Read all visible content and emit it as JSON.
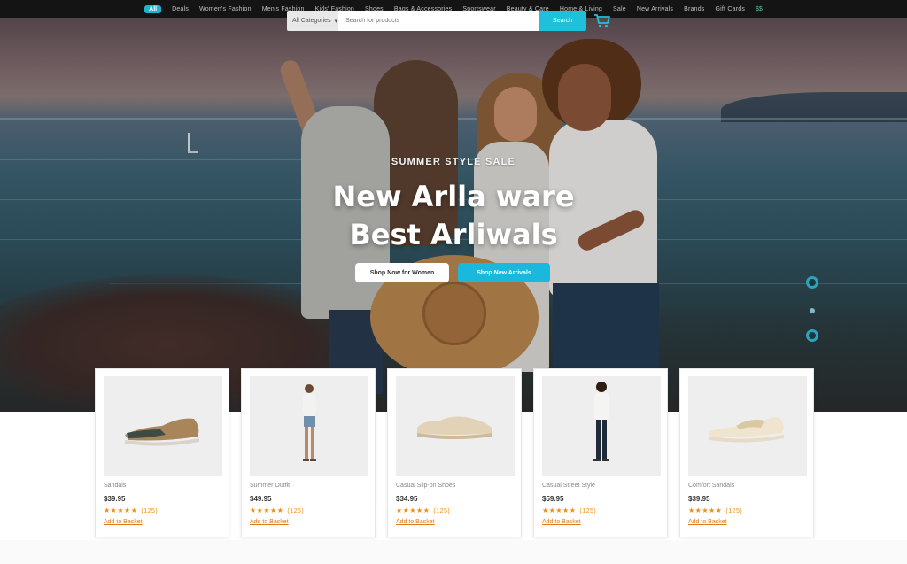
{
  "nav": {
    "badge": "All",
    "items": [
      "Deals",
      "Women's Fashion",
      "Men's Fashion",
      "Kids' Fashion",
      "Shoes",
      "Bags & Accessories",
      "Sportswear",
      "Beauty & Care",
      "Home & Living",
      "Sale",
      "New Arrivals",
      "Brands",
      "Gift Cards"
    ],
    "end": "$$"
  },
  "search": {
    "category": "All Categories",
    "placeholder": "Search for products",
    "button": "Search"
  },
  "hero": {
    "eyebrow": "SUMMER STYLE SALE",
    "title_line1": "New Arlla ware",
    "title_line2": "Best Arliwals",
    "cta_primary": "Shop Now for Women",
    "cta_secondary": "Shop New Arrivals"
  },
  "products": [
    {
      "name": "Sandals",
      "price": "$39.95",
      "rating": 4.5,
      "stars": "★★★★★",
      "count": "(125)",
      "link": "Add to Basket"
    },
    {
      "name": "Summer Outfit",
      "price": "$49.95",
      "rating": 4.5,
      "stars": "★★★★★",
      "count": "(125)",
      "link": "Add to Basket"
    },
    {
      "name": "Casual Slip-on Shoes",
      "price": "$34.95",
      "rating": 4.5,
      "stars": "★★★★★",
      "count": "(125)",
      "link": "Add to Basket"
    },
    {
      "name": "Casual Street Style",
      "price": "$59.95",
      "rating": 4.5,
      "stars": "★★★★★",
      "count": "(125)",
      "link": "Add to Basket"
    },
    {
      "name": "Comfort Sandals",
      "price": "$39.95",
      "rating": 4.5,
      "stars": "★★★★★",
      "count": "(125)",
      "link": "Add to Basket"
    }
  ],
  "colors": {
    "accent": "#19b8dc",
    "star": "#ef8c18",
    "nav_bg": "#141414"
  },
  "icons": {
    "cart": "shopping-cart-icon"
  }
}
